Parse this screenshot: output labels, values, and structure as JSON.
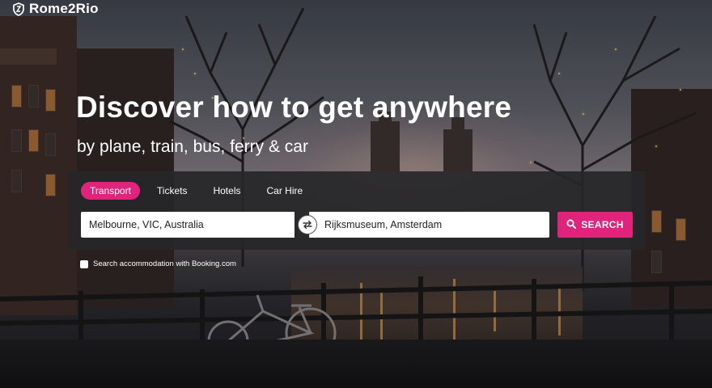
{
  "brand": {
    "name": "Rome2Rio",
    "icon": "rome2rio-shield-logo-icon"
  },
  "hero": {
    "title": "Discover how to get anywhere",
    "subtitle": "by plane, train, bus, ferry & car"
  },
  "search": {
    "tabs": [
      {
        "label": "Transport",
        "active": true
      },
      {
        "label": "Tickets",
        "active": false
      },
      {
        "label": "Hotels",
        "active": false
      },
      {
        "label": "Car Hire",
        "active": false
      }
    ],
    "from_value": "Melbourne, VIC, Australia",
    "to_value": "Rijksmuseum, Amsterdam",
    "swap_icon": "swap-arrows-icon",
    "button_label": "SEARCH",
    "button_icon": "search-icon",
    "booking_checkbox_label": "Search accommodation with Booking.com"
  },
  "colors": {
    "accent": "#e0237b",
    "panel": "#262628"
  }
}
